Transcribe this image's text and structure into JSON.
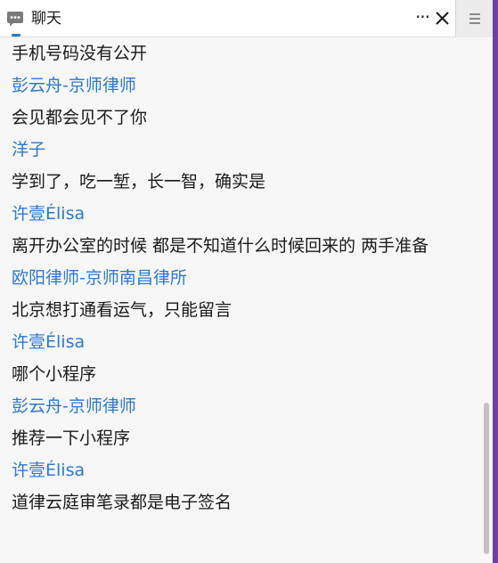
{
  "window": {
    "title": "聊天",
    "more_label": "···",
    "accent_color": "#2b78d4",
    "frame_color": "#6f3fa8"
  },
  "messages": [
    {
      "role": "content",
      "text": "手机号码没有公开"
    },
    {
      "role": "sender",
      "text": "彭云舟-京师律师"
    },
    {
      "role": "content",
      "text": "会见都会见不了你"
    },
    {
      "role": "sender",
      "text": "洋子"
    },
    {
      "role": "content",
      "text": "学到了，吃一堑，长一智，确实是"
    },
    {
      "role": "sender",
      "text": "许壹Élisa"
    },
    {
      "role": "content",
      "text": "离开办公室的时候  都是不知道什么时候回来的 两手准备"
    },
    {
      "role": "sender",
      "text": "欧阳律师-京师南昌律所"
    },
    {
      "role": "content",
      "text": "北京想打通看运气，只能留言"
    },
    {
      "role": "sender",
      "text": "许壹Élisa"
    },
    {
      "role": "content",
      "text": "哪个小程序"
    },
    {
      "role": "sender",
      "text": "彭云舟-京师律师"
    },
    {
      "role": "content",
      "text": "推荐一下小程序"
    },
    {
      "role": "sender",
      "text": "许壹Élisa"
    },
    {
      "role": "content",
      "text": "道律云庭审笔录都是电子签名"
    }
  ]
}
